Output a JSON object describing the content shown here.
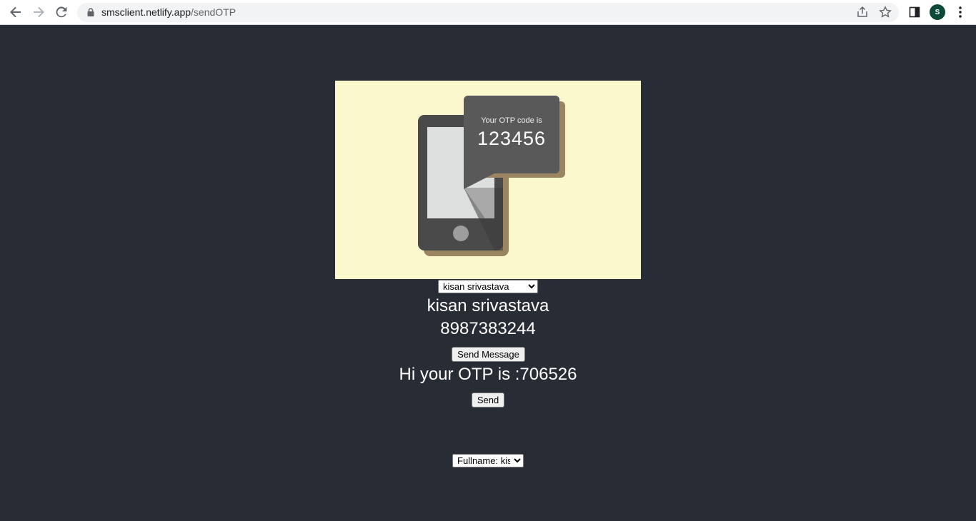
{
  "browser": {
    "url_host": "smsclient.netlify.app",
    "url_path": "/sendOTP",
    "profile_initial": "S"
  },
  "hero": {
    "bubble_caption": "Your OTP code is",
    "bubble_code": "123456",
    "colors": {
      "background": "#fcf8ce",
      "phone": "#4a4a4a",
      "shadow": "#9b8560",
      "screen": "#dedfdf"
    }
  },
  "form": {
    "user_select_value": "kisan srivastava",
    "contact_name": "kisan srivastava",
    "contact_phone": "8987383244",
    "send_message_label": "Send Message",
    "otp_message": "Hi your OTP is :706526",
    "send_label": "Send",
    "fullname_select_value": "Fullname: kis"
  },
  "colors": {
    "page_background": "#282c34",
    "text": "#ffffff"
  }
}
